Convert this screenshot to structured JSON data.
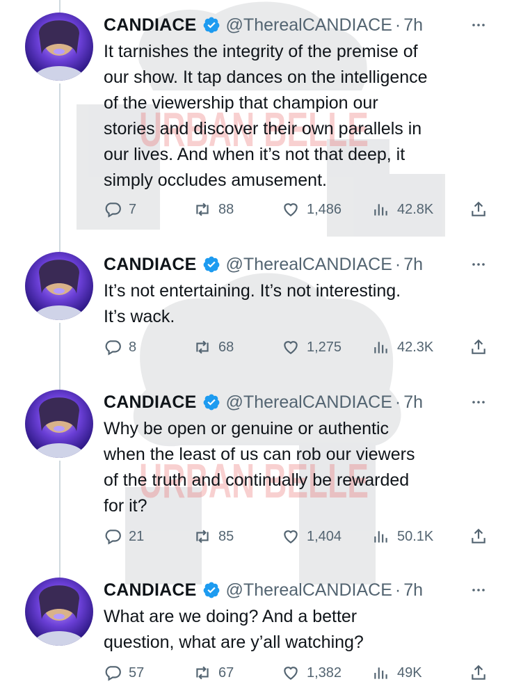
{
  "colors": {
    "text": "#0f1419",
    "secondary": "#536471",
    "verified": "#1d9bf0",
    "watermark": "#e85a5a"
  },
  "watermark_text": "URBAN BELLE",
  "tweets": [
    {
      "name": "CANDIACE",
      "handle": "@TherealCANDIACE",
      "separator": "·",
      "time": "7h",
      "text": "It tarnishes the integrity of the premise of\nour show. It tap dances on the intelligence\nof the viewership that champion our\nstories and discover their own parallels in\nour lives. And when it’s not that deep, it\nsimply occludes amusement.",
      "replies": "7",
      "retweets": "88",
      "likes": "1,486",
      "views": "42.8K"
    },
    {
      "name": "CANDIACE",
      "handle": "@TherealCANDIACE",
      "separator": "·",
      "time": "7h",
      "text": "It’s not entertaining. It’s not interesting.\nIt’s wack.",
      "replies": "8",
      "retweets": "68",
      "likes": "1,275",
      "views": "42.3K"
    },
    {
      "name": "CANDIACE",
      "handle": "@TherealCANDIACE",
      "separator": "·",
      "time": "7h",
      "text": "Why be open or genuine or authentic\nwhen the least of us can rob our viewers\nof the truth and continually be rewarded\nfor it?",
      "replies": "21",
      "retweets": "85",
      "likes": "1,404",
      "views": "50.1K"
    },
    {
      "name": "CANDIACE",
      "handle": "@TherealCANDIACE",
      "separator": "·",
      "time": "7h",
      "text": "What are we doing? And a better\nquestion, what are y’all watching?",
      "replies": "57",
      "retweets": "67",
      "likes": "1,382",
      "views": "49K"
    }
  ]
}
